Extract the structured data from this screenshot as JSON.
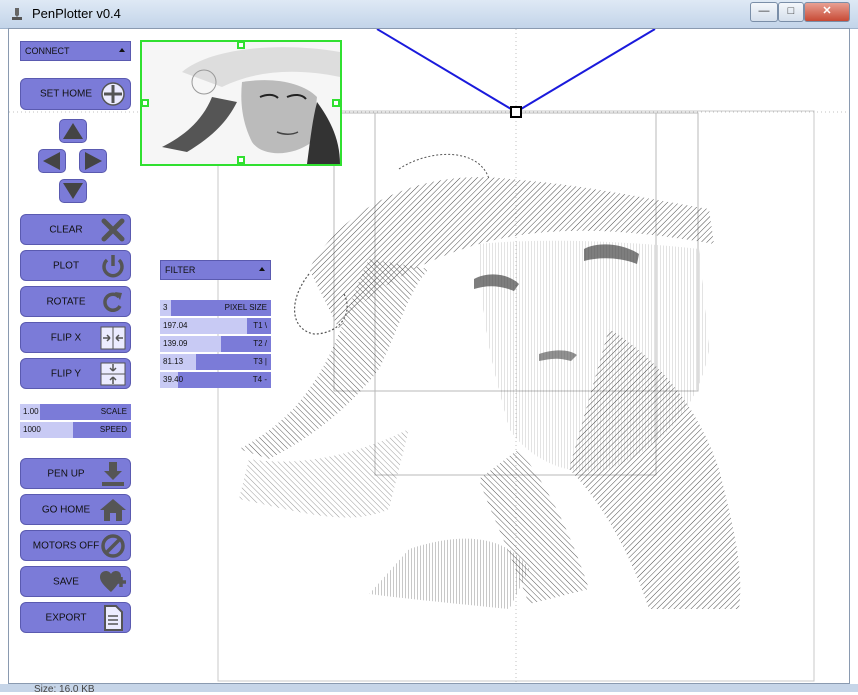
{
  "window": {
    "title": "PenPlotter v0.4",
    "minimize": "—",
    "maximize": "□",
    "close": "✕"
  },
  "footer": {
    "size_text": "Size: 16.0 KB"
  },
  "panel": {
    "connect_dropdown": "CONNECT",
    "filter_dropdown": "FILTER",
    "buttons": [
      {
        "key": "set_home",
        "label": "SET HOME",
        "icon": "crosshair-icon"
      },
      {
        "key": "clear",
        "label": "CLEAR",
        "icon": "x-icon"
      },
      {
        "key": "plot",
        "label": "PLOT",
        "icon": "power-icon"
      },
      {
        "key": "rotate",
        "label": "ROTATE",
        "icon": "rotate-icon"
      },
      {
        "key": "flip_x",
        "label": "FLIP X",
        "icon": "flip-horizontal-icon"
      },
      {
        "key": "flip_y",
        "label": "FLIP Y",
        "icon": "flip-vertical-icon"
      },
      {
        "key": "pen_up",
        "label": "PEN UP",
        "icon": "pen-up-icon"
      },
      {
        "key": "go_home",
        "label": "GO HOME",
        "icon": "home-icon"
      },
      {
        "key": "motors_off",
        "label": "MOTORS OFF",
        "icon": "no-entry-icon"
      },
      {
        "key": "save",
        "label": "SAVE",
        "icon": "heart-plus-icon"
      },
      {
        "key": "export",
        "label": "EXPORT",
        "icon": "document-icon"
      }
    ],
    "jog_arrows": [
      "up-arrow-icon",
      "left-arrow-icon",
      "right-arrow-icon",
      "down-arrow-icon"
    ],
    "scale_slider": {
      "value": "1.00",
      "name": "SCALE",
      "fill_fraction": 0.18
    },
    "speed_slider": {
      "value": "1000",
      "name": "SPEED",
      "fill_fraction": 0.48
    },
    "filter_sliders": [
      {
        "value": "3",
        "name": "PIXEL SIZE",
        "fill_fraction": 0.1
      },
      {
        "value": "197.04",
        "name": "T1 \\",
        "fill_fraction": 0.78
      },
      {
        "value": "139.09",
        "name": "T2 /",
        "fill_fraction": 0.55
      },
      {
        "value": "81.13",
        "name": "T3 |",
        "fill_fraction": 0.32
      },
      {
        "value": "39.40",
        "name": "T4 -",
        "fill_fraction": 0.16
      }
    ]
  },
  "colors": {
    "button": "#7b7bd8",
    "button_border": "#5a5ab0",
    "slider_fill": "#c8caf4",
    "thumb_border": "#30e030",
    "gondola_line": "#1a1adc"
  }
}
